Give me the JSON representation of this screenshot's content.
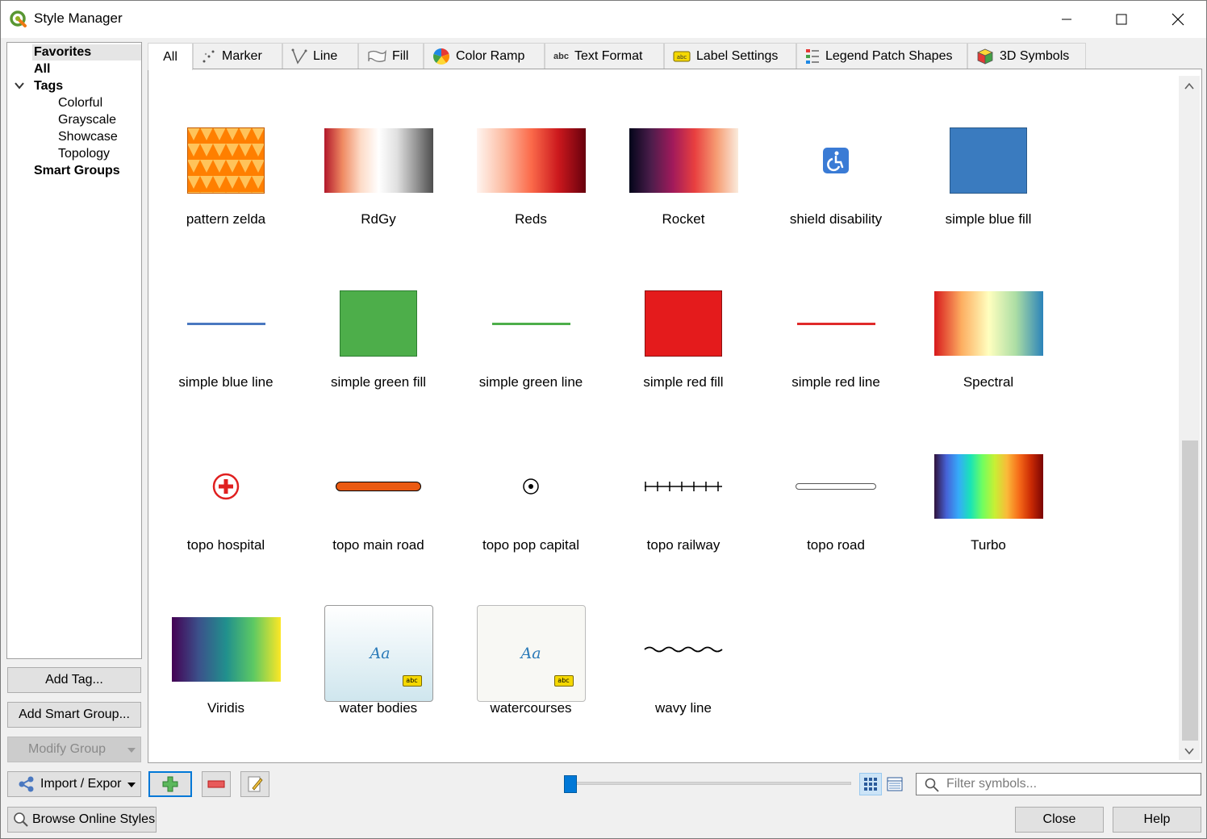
{
  "window": {
    "title": "Style Manager"
  },
  "sidebar": {
    "items": [
      {
        "label": "Favorites"
      },
      {
        "label": "All"
      },
      {
        "label": "Tags"
      },
      {
        "label": "Colorful"
      },
      {
        "label": "Grayscale"
      },
      {
        "label": "Showcase"
      },
      {
        "label": "Topology"
      },
      {
        "label": "Smart Groups"
      }
    ],
    "buttons": {
      "add_tag": "Add Tag...",
      "add_smart_group": "Add Smart Group...",
      "modify_group": "Modify Group",
      "import_export": "Import / Expor"
    }
  },
  "tabs": [
    {
      "label": "All",
      "icon": "none"
    },
    {
      "label": "Marker",
      "icon": "marker-icon"
    },
    {
      "label": "Line",
      "icon": "line-icon"
    },
    {
      "label": "Fill",
      "icon": "fill-icon"
    },
    {
      "label": "Color Ramp",
      "icon": "color-ramp-icon"
    },
    {
      "label": "Text Format",
      "icon": "text-format-icon"
    },
    {
      "label": "Label Settings",
      "icon": "label-settings-icon"
    },
    {
      "label": "Legend Patch Shapes",
      "icon": "legend-patch-icon"
    },
    {
      "label": "3D Symbols",
      "icon": "3d-symbols-icon"
    }
  ],
  "symbols": [
    {
      "name": "pattern zelda",
      "kind": "pattern"
    },
    {
      "name": "RdGy",
      "kind": "ramp"
    },
    {
      "name": "Reds",
      "kind": "ramp"
    },
    {
      "name": "Rocket",
      "kind": "ramp"
    },
    {
      "name": "shield disability",
      "kind": "marker"
    },
    {
      "name": "simple blue fill",
      "kind": "fill",
      "color": "#3a7bbf"
    },
    {
      "name": "simple blue line",
      "kind": "line",
      "color": "#4a78c0"
    },
    {
      "name": "simple green fill",
      "kind": "fill",
      "color": "#4dae4a"
    },
    {
      "name": "simple green line",
      "kind": "line",
      "color": "#4dae4a"
    },
    {
      "name": "simple red fill",
      "kind": "fill",
      "color": "#e41b1c"
    },
    {
      "name": "simple red line",
      "kind": "line",
      "color": "#e02a2a"
    },
    {
      "name": "Spectral",
      "kind": "ramp"
    },
    {
      "name": "topo hospital",
      "kind": "marker"
    },
    {
      "name": "topo main road",
      "kind": "line",
      "color": "#ea5a12"
    },
    {
      "name": "topo pop capital",
      "kind": "marker"
    },
    {
      "name": "topo railway",
      "kind": "line"
    },
    {
      "name": "topo road",
      "kind": "line"
    },
    {
      "name": "Turbo",
      "kind": "ramp"
    },
    {
      "name": "Viridis",
      "kind": "ramp"
    },
    {
      "name": "water bodies",
      "kind": "label",
      "sample": "Aa",
      "badge": "abc"
    },
    {
      "name": "watercourses",
      "kind": "label",
      "sample": "Aa",
      "badge": "abc"
    },
    {
      "name": "wavy line",
      "kind": "line"
    }
  ],
  "toolbar": {
    "filter_placeholder": "Filter symbols...",
    "icon_size_fraction": 0.0
  },
  "footer": {
    "browse_online": "Browse Online Styles",
    "close": "Close",
    "help": "Help"
  },
  "colors": {
    "accent": "#0078d7"
  }
}
